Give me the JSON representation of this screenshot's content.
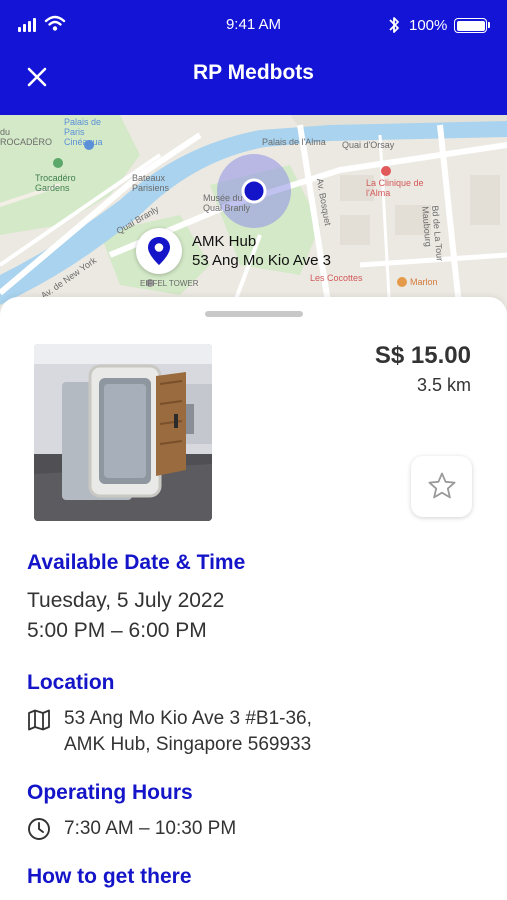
{
  "status_bar": {
    "time": "9:41 AM",
    "battery": "100%",
    "icons": [
      "signal-icon",
      "wifi-icon",
      "bluetooth-icon",
      "battery-icon"
    ]
  },
  "header": {
    "title": "RP Medbots",
    "close_icon": "close-icon",
    "background": "#1414d6"
  },
  "map": {
    "pin_label_line1": "AMK Hub",
    "pin_label_line2": "53 Ang Mo Kio Ave 3",
    "place_labels": [
      "Palais de l'Alma",
      "Quai d'Orsay",
      "La Clinique de l'Alma",
      "Trocadéro Gardens",
      "Bateaux Parisiens",
      "Musée du Quai Branly",
      "Av. de New York",
      "Quai Branly",
      "Av. Bosquet",
      "Les Cocottes",
      "Marlon",
      "EIFFEL TOWER",
      "Bd de La Tour Maubourg",
      "Palais de Paris Cinéaqua",
      "du ROCADÉRO"
    ]
  },
  "listing": {
    "price": "S$ 15.00",
    "distance": "3.5 km",
    "favorite_icon": "star-icon"
  },
  "availability": {
    "title": "Available Date & Time",
    "date": "Tuesday, 5 July 2022",
    "time_range": "5:00 PM – 6:00 PM"
  },
  "location": {
    "title": "Location",
    "icon": "map-icon",
    "address_line1": "53 Ang Mo Kio Ave 3 #B1-36,",
    "address_line2": "AMK Hub, Singapore 569933"
  },
  "hours": {
    "title": "Operating Hours",
    "icon": "clock-icon",
    "value": "7:30 AM – 10:30 PM"
  },
  "directions": {
    "title": "How to get there"
  },
  "colors": {
    "accent": "#1414c8",
    "text": "#333333",
    "map_water": "#a9d3ee",
    "map_park": "#cfe8c4"
  }
}
